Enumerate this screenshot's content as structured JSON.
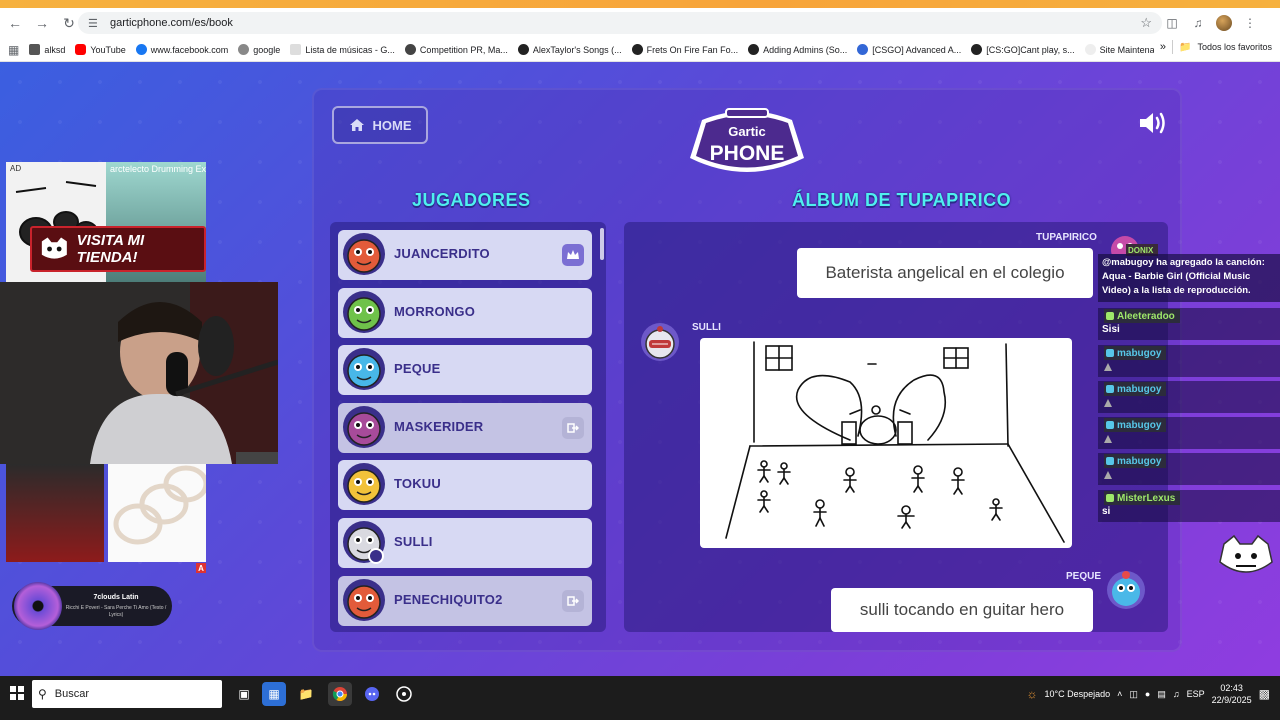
{
  "browser": {
    "url": "garticphone.com/es/book",
    "bookmarks": [
      {
        "label": "alksd",
        "color": "#555555"
      },
      {
        "label": "YouTube",
        "color": "#ff0000"
      },
      {
        "label": "www.facebook.com",
        "color": "#1877f2"
      },
      {
        "label": "google",
        "color": "#888888"
      },
      {
        "label": "Lista de músicas - G...",
        "color": "#dddddd"
      },
      {
        "label": "Competition PR, Ma...",
        "color": "#444444"
      },
      {
        "label": "AlexTaylor's Songs (...",
        "color": "#222222"
      },
      {
        "label": "Frets On Fire Fan Fo...",
        "color": "#222222"
      },
      {
        "label": "Adding Admins (So...",
        "color": "#222222"
      },
      {
        "label": "[CSGO] Advanced A...",
        "color": "#3367d6"
      },
      {
        "label": "[CS:GO]Cant play, s...",
        "color": "#222222"
      },
      {
        "label": "Site Maintenance",
        "color": "#eeeeee"
      }
    ],
    "all_bookmarks_label": "Todos los favoritos"
  },
  "game": {
    "home_label": "HOME",
    "logo_line1": "Gartic",
    "logo_line2": "PHONE",
    "players_title": "JUGADORES",
    "album_title": "ÁLBUM DE TUPAPIRICO",
    "players": [
      {
        "name": "JUANCERDITO",
        "badge": "crown",
        "color": "#e25b3a"
      },
      {
        "name": "MORRONGO",
        "badge": "",
        "color": "#6fc24a"
      },
      {
        "name": "PEQUE",
        "badge": "",
        "color": "#48b7e8"
      },
      {
        "name": "MASKERIDER",
        "badge": "exit",
        "color": "#a74b9a"
      },
      {
        "name": "TOKUU",
        "badge": "",
        "color": "#f2c23a"
      },
      {
        "name": "SULLI",
        "badge": "user",
        "color": "#d9d9e0"
      },
      {
        "name": "PENECHIQUITO2",
        "badge": "exit",
        "color": "#e25b3a"
      }
    ],
    "album": {
      "entries": [
        {
          "author": "TUPAPIRICO",
          "text": "Baterista angelical en el colegio"
        },
        {
          "author": "SULLI",
          "text": ""
        },
        {
          "author": "PEQUE",
          "text": "sulli tocando en guitar hero"
        }
      ]
    }
  },
  "overlay": {
    "ad_label": "AD",
    "ad_title": "arctelecto Drumming Experie",
    "store_label": "VISITA MI TIENDA!",
    "ad_badge": "A",
    "music_title": "7clouds Latin",
    "music_sub": "Ricchi E Poveri - Sara Perche Ti Amo (Testo / Lyrics)"
  },
  "chat": {
    "top_tag": "DONIX",
    "notice": "@mabugoy ha agregado la canción: Aqua - Barbie Girl (Official Music Video) a la lista de reproducción.",
    "messages": [
      {
        "user": "Aleeteradoo",
        "user_color": "#9ee86a",
        "text": "Sisi"
      },
      {
        "user": "mabugoy",
        "user_color": "#57c7e8",
        "text": ""
      },
      {
        "user": "mabugoy",
        "user_color": "#57c7e8",
        "text": ""
      },
      {
        "user": "mabugoy",
        "user_color": "#57c7e8",
        "text": ""
      },
      {
        "user": "mabugoy",
        "user_color": "#57c7e8",
        "text": ""
      },
      {
        "user": "MisterLexus",
        "user_color": "#9ee86a",
        "text": "si"
      }
    ]
  },
  "taskbar": {
    "search_placeholder": "Buscar",
    "weather": "10°C  Despejado",
    "lang": "ESP",
    "time": "02:43",
    "date": "22/9/2025"
  }
}
